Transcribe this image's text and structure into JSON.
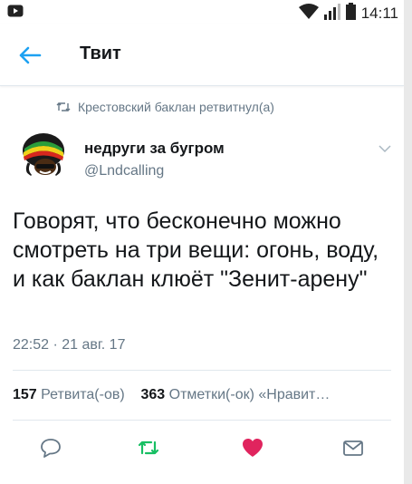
{
  "status_bar": {
    "time": "14:11",
    "icons": [
      "notification-icon",
      "wifi-icon",
      "signal-icon",
      "battery-icon"
    ]
  },
  "header": {
    "title": "Твит",
    "back_icon": "arrow-left-icon"
  },
  "retweet": {
    "text": "Крестовский баклан ретвитнул(а)",
    "icon": "retweet-icon"
  },
  "author": {
    "name": "недруги за бугром",
    "handle": "@Lndcalling"
  },
  "tweet": {
    "text": "Говорят, что бесконечно можно смотреть на три вещи: огонь, воду, и как баклан клюёт \"Зенит-арену\"",
    "timestamp": "22:52 · 21 авг. 17"
  },
  "stats": {
    "retweet_count": "157",
    "retweet_label": "Ретвита(-ов)",
    "like_count": "363",
    "like_label": "Отметки(-ок) «Нравит…"
  },
  "actions": {
    "reply_icon": "reply-icon",
    "retweet_icon": "retweet-icon",
    "like_icon": "heart-icon",
    "message_icon": "envelope-icon"
  },
  "colors": {
    "accent": "#1da1f2",
    "retweeted": "#17bf63",
    "liked": "#e0245e",
    "secondary_text": "#657786"
  }
}
